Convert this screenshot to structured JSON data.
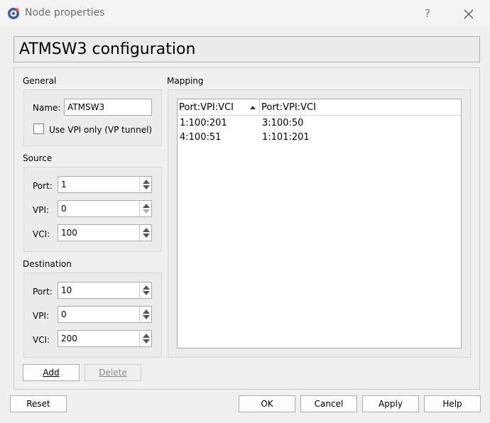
{
  "window": {
    "title": "Node properties",
    "help_glyph": "?"
  },
  "header": {
    "title": "ATMSW3 configuration"
  },
  "general": {
    "group_title": "General",
    "name_label": "Name:",
    "name_value": "ATMSW3",
    "vpi_only_label": "Use VPI only (VP tunnel)",
    "vpi_only_checked": false
  },
  "source": {
    "group_title": "Source",
    "port_label": "Port:",
    "port_value": "1",
    "vpi_label": "VPI:",
    "vpi_value": "0",
    "vci_label": "VCI:",
    "vci_value": "100"
  },
  "destination": {
    "group_title": "Destination",
    "port_label": "Port:",
    "port_value": "10",
    "vpi_label": "VPI:",
    "vpi_value": "0",
    "vci_label": "VCI:",
    "vci_value": "200"
  },
  "actions": {
    "add_label": "Add",
    "delete_label": "Delete"
  },
  "mapping": {
    "group_title": "Mapping",
    "columns": [
      "Port:VPI:VCI",
      "Port:VPI:VCI"
    ],
    "rows": [
      [
        "1:100:201",
        "3:100:50"
      ],
      [
        "4:100:51",
        "1:101:201"
      ]
    ]
  },
  "footer": {
    "reset_label": "Reset",
    "ok_label": "OK",
    "cancel_label": "Cancel",
    "apply_label": "Apply",
    "help_label": "Help"
  }
}
